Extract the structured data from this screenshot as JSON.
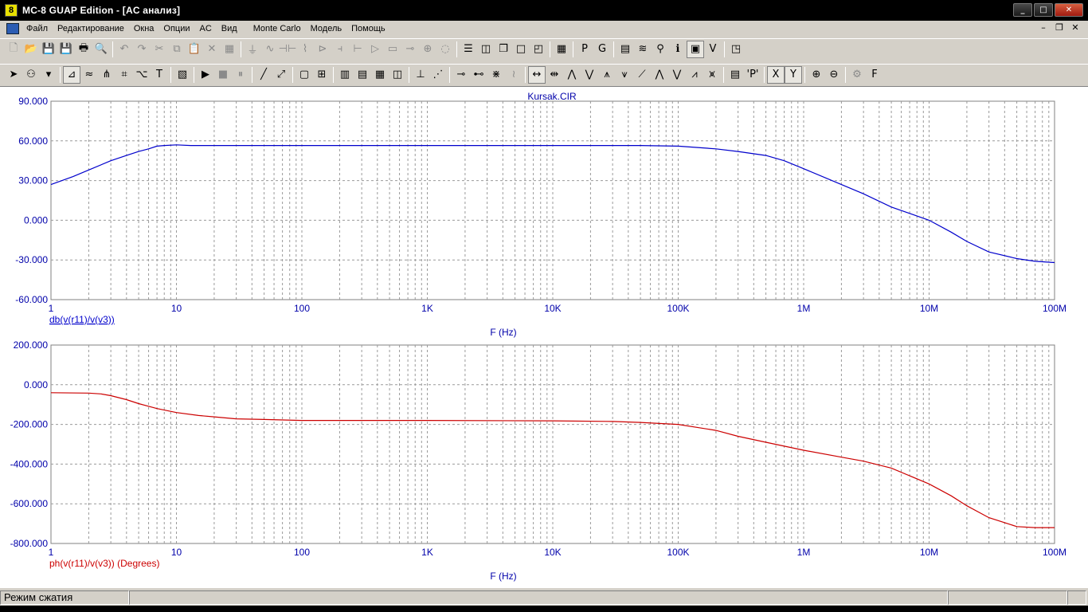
{
  "window": {
    "title": "MC-8 GUAP Edition - [AC анализ]",
    "buttons": [
      "_",
      "□",
      "✕"
    ]
  },
  "menu": {
    "items": [
      "Файл",
      "Редактирование",
      "Окна",
      "Опции",
      "AC",
      "Вид",
      "Monte Carlo",
      "Модель",
      "Помощь"
    ],
    "mdi_buttons": [
      "–",
      "❐",
      "✕"
    ]
  },
  "toolbar1": {
    "buttons": [
      {
        "name": "new-file-icon",
        "glyph": "🗋",
        "enabled": false
      },
      {
        "name": "open-folder-icon",
        "glyph": "📂",
        "enabled": false
      },
      {
        "name": "save-icon",
        "glyph": "💾",
        "enabled": false
      },
      {
        "name": "save-all-icon",
        "glyph": "💾",
        "enabled": false
      },
      {
        "name": "print-icon",
        "glyph": "🖶",
        "enabled": true
      },
      {
        "name": "print-preview-icon",
        "glyph": "🔍",
        "enabled": true
      },
      {
        "sep": true
      },
      {
        "name": "undo-icon",
        "glyph": "↶",
        "enabled": false
      },
      {
        "name": "redo-icon",
        "glyph": "↷",
        "enabled": false
      },
      {
        "name": "cut-icon",
        "glyph": "✂",
        "enabled": false
      },
      {
        "name": "copy-icon",
        "glyph": "⧉",
        "enabled": false
      },
      {
        "name": "paste-icon",
        "glyph": "📋",
        "enabled": false
      },
      {
        "name": "delete-icon",
        "glyph": "✕",
        "enabled": false
      },
      {
        "name": "select-all-icon",
        "glyph": "▦",
        "enabled": false
      },
      {
        "sep": true
      },
      {
        "name": "ground-icon",
        "glyph": "⏚",
        "enabled": false
      },
      {
        "name": "wire-icon",
        "glyph": "∿",
        "enabled": false
      },
      {
        "name": "capacitor-icon",
        "glyph": "⊣⊢",
        "enabled": false
      },
      {
        "name": "resistor-icon",
        "glyph": "⌇",
        "enabled": false
      },
      {
        "name": "diode-icon",
        "glyph": "⊳",
        "enabled": false
      },
      {
        "name": "battery-icon",
        "glyph": "⫞",
        "enabled": false
      },
      {
        "name": "transistor-icon",
        "glyph": "⊢",
        "enabled": false
      },
      {
        "name": "opamp-icon",
        "glyph": "▷",
        "enabled": false
      },
      {
        "name": "macro-icon",
        "glyph": "▭",
        "enabled": false
      },
      {
        "name": "switch-icon",
        "glyph": "⊸",
        "enabled": false
      },
      {
        "name": "source-icon",
        "glyph": "⊕",
        "enabled": false
      },
      {
        "name": "bulb-icon",
        "glyph": "◌",
        "enabled": false
      },
      {
        "sep": true
      },
      {
        "name": "tile-horizontal-icon",
        "glyph": "☰",
        "enabled": true
      },
      {
        "name": "tile-vertical-icon",
        "glyph": "◫",
        "enabled": true
      },
      {
        "name": "cascade-icon",
        "glyph": "❐",
        "enabled": true
      },
      {
        "name": "maximize-window-icon",
        "glyph": "□",
        "enabled": true
      },
      {
        "name": "restore-window-icon",
        "glyph": "◰",
        "enabled": true
      },
      {
        "sep": true
      },
      {
        "name": "calculator-icon",
        "glyph": "▦",
        "enabled": true
      },
      {
        "sep": true
      },
      {
        "name": "p-command-icon",
        "glyph": "P",
        "enabled": true
      },
      {
        "name": "g-command-icon",
        "glyph": "G",
        "enabled": true
      },
      {
        "sep": true
      },
      {
        "name": "component-list-icon",
        "glyph": "▤",
        "enabled": true
      },
      {
        "name": "waveform-icon",
        "glyph": "≋",
        "enabled": true
      },
      {
        "name": "probe-icon",
        "glyph": "⚲",
        "enabled": true
      },
      {
        "name": "info-icon",
        "glyph": "ℹ",
        "enabled": true
      },
      {
        "name": "plot-window-icon",
        "glyph": "▣",
        "enabled": true,
        "active": true
      },
      {
        "name": "vid-icon",
        "glyph": "V",
        "enabled": true
      },
      {
        "sep": true
      },
      {
        "name": "analysis-window-icon",
        "glyph": "◳",
        "enabled": true
      }
    ]
  },
  "toolbar2": {
    "buttons": [
      {
        "name": "select-arrow-icon",
        "glyph": "➤",
        "enabled": true
      },
      {
        "name": "component-mode-icon",
        "glyph": "⚇",
        "enabled": true
      },
      {
        "name": "dropdown-arrow-icon",
        "glyph": "▾",
        "enabled": true
      },
      {
        "sep": true
      },
      {
        "name": "scale-icon",
        "glyph": "⊿",
        "enabled": true,
        "active": true
      },
      {
        "name": "cursor-mode-icon",
        "glyph": "≈",
        "enabled": true
      },
      {
        "name": "tokens-icon",
        "glyph": "⋔",
        "enabled": true
      },
      {
        "name": "data-points-icon",
        "glyph": "⌗",
        "enabled": true
      },
      {
        "name": "tag-icon",
        "glyph": "⌥",
        "enabled": true
      },
      {
        "name": "text-icon",
        "glyph": "T",
        "enabled": true
      },
      {
        "sep": true
      },
      {
        "name": "properties-icon",
        "glyph": "▧",
        "enabled": true
      },
      {
        "sep": true
      },
      {
        "name": "run-icon",
        "glyph": "▶",
        "enabled": true
      },
      {
        "name": "stop-icon",
        "glyph": "■",
        "enabled": false
      },
      {
        "name": "pause-icon",
        "glyph": "⏸",
        "enabled": false
      },
      {
        "sep": true
      },
      {
        "name": "line-icon",
        "glyph": "╱",
        "enabled": true
      },
      {
        "name": "line-arrow-icon",
        "glyph": "⤢",
        "enabled": true
      },
      {
        "sep": true
      },
      {
        "name": "frame-icon",
        "glyph": "▢",
        "enabled": true
      },
      {
        "name": "grid-icon",
        "glyph": "⊞",
        "enabled": true
      },
      {
        "sep": true
      },
      {
        "name": "minor-grid-icon",
        "glyph": "▥",
        "enabled": true
      },
      {
        "name": "major-grid-icon",
        "glyph": "▤",
        "enabled": true
      },
      {
        "name": "table-grid-icon",
        "glyph": "▦",
        "enabled": true
      },
      {
        "name": "column-grid-icon",
        "glyph": "◫",
        "enabled": true
      },
      {
        "sep": true
      },
      {
        "name": "baseline-icon",
        "glyph": "⊥",
        "enabled": true
      },
      {
        "name": "dotted-line-icon",
        "glyph": "⋰",
        "enabled": true
      },
      {
        "sep": true
      },
      {
        "name": "cursor-left-icon",
        "glyph": "⊸",
        "enabled": true
      },
      {
        "name": "cursor-right-icon",
        "glyph": "⊷",
        "enabled": true
      },
      {
        "name": "cursor-both-icon",
        "glyph": "⋇",
        "enabled": true
      },
      {
        "name": "curve-icon",
        "glyph": "≀",
        "enabled": false
      },
      {
        "sep": true
      },
      {
        "name": "horizontal-cursor-icon",
        "glyph": "↔",
        "enabled": true,
        "active": true
      },
      {
        "name": "horizontal-center-icon",
        "glyph": "⇹",
        "enabled": true
      },
      {
        "name": "peak-icon",
        "glyph": "⋀",
        "enabled": true
      },
      {
        "name": "valley-icon",
        "glyph": "⋁",
        "enabled": true
      },
      {
        "name": "next-peak-icon",
        "glyph": "⩚",
        "enabled": true
      },
      {
        "name": "next-valley-icon",
        "glyph": "⩛",
        "enabled": true
      },
      {
        "name": "slope-icon",
        "glyph": "⟋",
        "enabled": true
      },
      {
        "name": "high-icon",
        "glyph": "⋀",
        "enabled": true
      },
      {
        "name": "low-icon",
        "glyph": "⋁",
        "enabled": true
      },
      {
        "name": "inflection-icon",
        "glyph": "⩘",
        "enabled": true
      },
      {
        "name": "global-high-icon",
        "glyph": "⩙",
        "enabled": true
      },
      {
        "sep": true
      },
      {
        "name": "data-table-icon",
        "glyph": "▤",
        "enabled": true
      },
      {
        "name": "p-marker-icon",
        "glyph": "'P'",
        "enabled": true
      },
      {
        "sep": true
      },
      {
        "name": "x-cursor-icon",
        "glyph": "X",
        "enabled": true,
        "active": true
      },
      {
        "name": "y-cursor-icon",
        "glyph": "Y",
        "enabled": true,
        "active": true
      },
      {
        "sep": true
      },
      {
        "name": "zoom-in-icon",
        "glyph": "⊕",
        "enabled": true
      },
      {
        "name": "zoom-out-icon",
        "glyph": "⊖",
        "enabled": true
      },
      {
        "sep": true
      },
      {
        "name": "gear-icon",
        "glyph": "⚙",
        "enabled": false
      },
      {
        "name": "font-icon",
        "glyph": "F",
        "enabled": true
      }
    ]
  },
  "charts": {
    "title": "Kursak.CIR",
    "colors": {
      "title": "#0000aa",
      "blue": "#0000cc",
      "red": "#cc0000",
      "grid": "#9a9a9a"
    }
  },
  "chart_data": [
    {
      "type": "line",
      "title": "Kursak.CIR",
      "x_scale": "log",
      "xlim": [
        1,
        100000000
      ],
      "xticks": [
        "1",
        "10",
        "100",
        "1K",
        "10K",
        "100K",
        "1M",
        "10M",
        "100M"
      ],
      "xlabel": "F (Hz)",
      "ylim": [
        -60,
        90
      ],
      "yticks": [
        "90.000",
        "60.000",
        "30.000",
        "0.000",
        "-30.000",
        "-60.000"
      ],
      "series": [
        {
          "name": "db(v(r11)/v(v3))",
          "color": "#0000cc",
          "x": [
            1,
            1.5,
            2,
            3,
            4,
            5,
            6,
            7,
            8,
            10,
            13,
            20,
            50,
            100,
            1000,
            10000,
            50000,
            100000,
            200000,
            300000,
            500000,
            700000,
            1000000,
            2000000,
            3000000,
            5000000,
            10000000,
            15000000,
            20000000,
            30000000,
            50000000,
            70000000,
            100000000
          ],
          "y": [
            27,
            33,
            38,
            45,
            49,
            52,
            54,
            56,
            56.5,
            57,
            56.5,
            56.5,
            56.5,
            56.5,
            56.5,
            56.5,
            56.5,
            56,
            54,
            52,
            49,
            45,
            39,
            27,
            20,
            10,
            0,
            -9,
            -16,
            -24,
            -29,
            -31,
            -32
          ]
        }
      ]
    },
    {
      "type": "line",
      "xlim": [
        1,
        100000000
      ],
      "x_scale": "log",
      "xticks": [
        "1",
        "10",
        "100",
        "1K",
        "10K",
        "100K",
        "1M",
        "10M",
        "100M"
      ],
      "xlabel": "F (Hz)",
      "ylim": [
        -800,
        200
      ],
      "yticks": [
        "200.000",
        "0.000",
        "-200.000",
        "-400.000",
        "-600.000",
        "-800.000"
      ],
      "series": [
        {
          "name": "ph(v(r11)/v(v3)) (Degrees)",
          "color": "#cc0000",
          "x": [
            1,
            2,
            2.5,
            3,
            4,
            5,
            7,
            10,
            15,
            20,
            30,
            50,
            100,
            1000,
            10000,
            30000,
            50000,
            100000,
            200000,
            300000,
            500000,
            1000000,
            2000000,
            3000000,
            5000000,
            10000000,
            15000000,
            20000000,
            30000000,
            50000000,
            70000000,
            100000000
          ],
          "y": [
            -40,
            -42,
            -46,
            -55,
            -75,
            -95,
            -120,
            -140,
            -155,
            -162,
            -172,
            -175,
            -180,
            -180,
            -182,
            -185,
            -190,
            -200,
            -230,
            -260,
            -290,
            -330,
            -365,
            -385,
            -420,
            -500,
            -560,
            -610,
            -670,
            -715,
            -720,
            -720
          ]
        }
      ]
    }
  ],
  "status": {
    "mode": "Режим сжатия",
    "panel2": "",
    "panel3": "",
    "panel4": ""
  }
}
